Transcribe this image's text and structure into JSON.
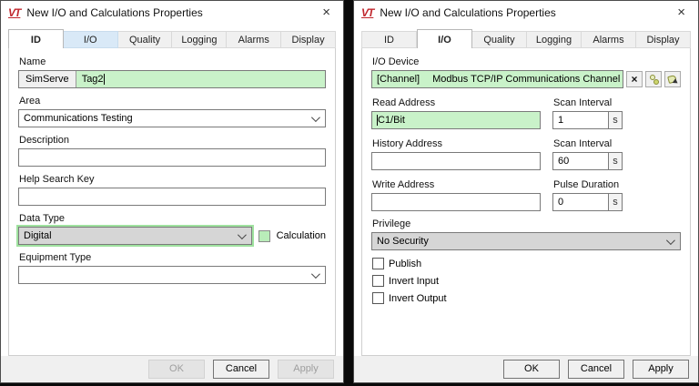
{
  "colors": {
    "highlight_green": "#c9f2c9",
    "logo_red": "#c0272d",
    "tab_hover_blue": "#d9e9f7"
  },
  "dialogs": [
    {
      "title": "New I/O and Calculations Properties",
      "logo_text": "VT",
      "close_glyph": "×",
      "tabs": [
        {
          "label": "ID"
        },
        {
          "label": "I/O"
        },
        {
          "label": "Quality"
        },
        {
          "label": "Logging"
        },
        {
          "label": "Alarms"
        },
        {
          "label": "Display"
        }
      ],
      "name": {
        "label": "Name",
        "prefix": "SimServe",
        "value": "Tag2"
      },
      "area": {
        "label": "Area",
        "value": "Communications Testing"
      },
      "description": {
        "label": "Description",
        "value": ""
      },
      "help_search_key": {
        "label": "Help Search Key",
        "value": ""
      },
      "data_type": {
        "label": "Data Type",
        "value": "Digital"
      },
      "calculation": {
        "label": "Calculation",
        "checked": false
      },
      "equipment_type": {
        "label": "Equipment Type",
        "value": ""
      },
      "buttons": {
        "ok": "OK",
        "cancel": "Cancel",
        "apply": "Apply"
      }
    },
    {
      "title": "New I/O and Calculations Properties",
      "logo_text": "VT",
      "close_glyph": "×",
      "tabs": [
        {
          "label": "ID"
        },
        {
          "label": "I/O"
        },
        {
          "label": "Quality"
        },
        {
          "label": "Logging"
        },
        {
          "label": "Alarms"
        },
        {
          "label": "Display"
        }
      ],
      "io_device": {
        "label": "I/O Device",
        "channel_type": "[Channel]",
        "value": "Modbus TCP/IP Communications Channel",
        "clear_glyph": "×"
      },
      "read_address": {
        "label": "Read Address",
        "value": "C1/Bit"
      },
      "scan_interval_1": {
        "label": "Scan Interval",
        "value": "1",
        "unit": "s"
      },
      "history_address": {
        "label": "History Address",
        "value": ""
      },
      "scan_interval_2": {
        "label": "Scan Interval",
        "value": "60",
        "unit": "s"
      },
      "write_address": {
        "label": "Write Address",
        "value": ""
      },
      "pulse_duration": {
        "label": "Pulse Duration",
        "value": "0",
        "unit": "s"
      },
      "privilege": {
        "label": "Privilege",
        "value": "No Security"
      },
      "checkboxes": [
        {
          "label": "Publish",
          "checked": false
        },
        {
          "label": "Invert Input",
          "checked": false
        },
        {
          "label": "Invert Output",
          "checked": false
        }
      ],
      "buttons": {
        "ok": "OK",
        "cancel": "Cancel",
        "apply": "Apply"
      }
    }
  ]
}
